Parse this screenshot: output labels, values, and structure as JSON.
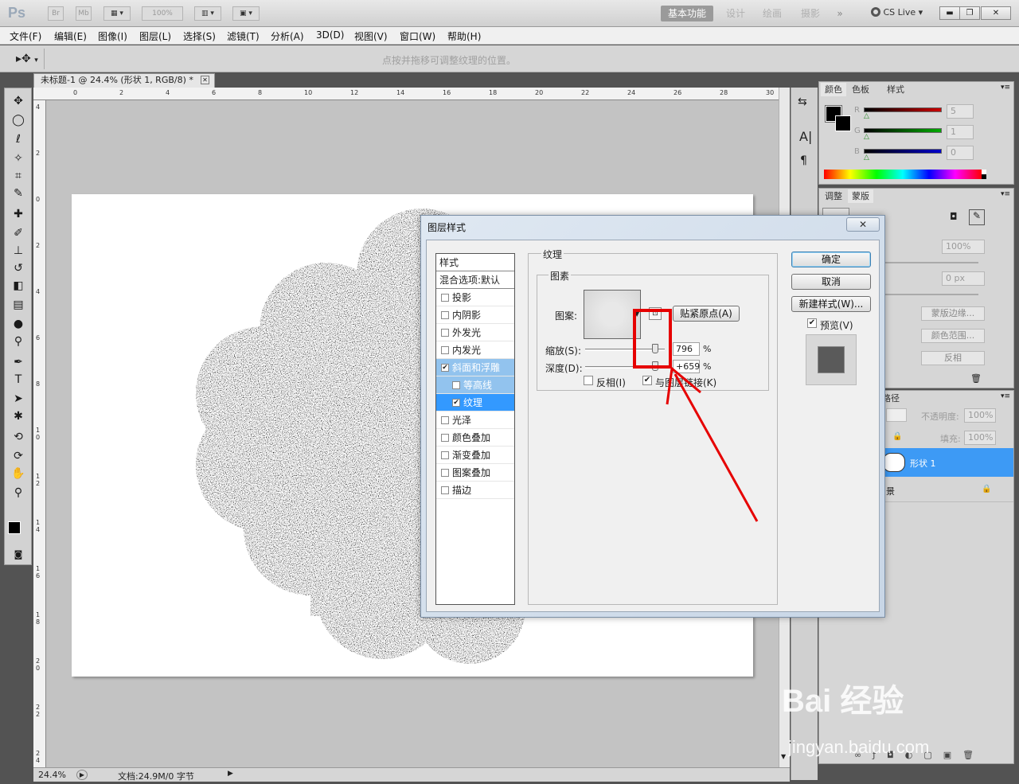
{
  "app": {
    "logo": "Ps",
    "bridge": "Br",
    "minibridge": "Mb",
    "zoom_menu": "100%",
    "workspaces": [
      "基本功能",
      "设计",
      "绘画",
      "摄影"
    ],
    "more": "»",
    "cs_live": "CS Live ▾",
    "win_min": "▬",
    "win_max": "❐",
    "win_close": "✕"
  },
  "menu": [
    "文件(F)",
    "编辑(E)",
    "图像(I)",
    "图层(L)",
    "选择(S)",
    "滤镜(T)",
    "分析(A)",
    "3D(D)",
    "视图(V)",
    "窗口(W)",
    "帮助(H)"
  ],
  "options": {
    "hint": "点按并拖移可调整纹理的位置。"
  },
  "document": {
    "tab_title": "未标题-1 @ 24.4% (形状 1, RGB/8) *",
    "tab_close": "✕",
    "ruler_h": [
      "0",
      "2",
      "4",
      "6",
      "8",
      "10",
      "12",
      "14",
      "16",
      "18",
      "20",
      "22",
      "24",
      "26",
      "28",
      "30"
    ],
    "ruler_v": [
      "4",
      "2",
      "0",
      "2",
      "4",
      "6",
      "8",
      "10",
      "12",
      "14",
      "16",
      "18",
      "20",
      "22",
      "24"
    ],
    "zoom": "24.4%",
    "doc_size": "文档:24.9M/0 字节"
  },
  "panels": {
    "color_tabs": [
      "颜色",
      "色板",
      "样式"
    ],
    "color_rows": [
      {
        "label": "R",
        "value": "5",
        "color": "#cc0000"
      },
      {
        "label": "G",
        "value": "1",
        "color": "#00aa00"
      },
      {
        "label": "B",
        "value": "0",
        "color": "#0000cc"
      }
    ],
    "adjust_tabs": [
      "调整",
      "蒙版"
    ],
    "adjust_density": "100%",
    "adjust_feather": "0 px",
    "adjust_buttons": [
      "蒙版边缘...",
      "颜色范围...",
      "反相"
    ],
    "layers_tab": "路径",
    "layer_opacity_label": "不透明度:",
    "layer_opacity": "100%",
    "layer_fill_label": "填充:",
    "layer_fill": "100%",
    "layer_shape_name": "形状 1",
    "layer_bg_name": "景"
  },
  "dialog": {
    "title": "图层样式",
    "close": "✕",
    "style_header": "样式",
    "blend_default": "混合选项:默认",
    "styles": [
      {
        "label": "投影",
        "checked": false
      },
      {
        "label": "内阴影",
        "checked": false
      },
      {
        "label": "外发光",
        "checked": false
      },
      {
        "label": "内发光",
        "checked": false
      },
      {
        "label": "斜面和浮雕",
        "checked": true,
        "state": "parent"
      },
      {
        "label": "等高线",
        "checked": false,
        "state": "sub"
      },
      {
        "label": "纹理",
        "checked": true,
        "state": "sub-selected"
      },
      {
        "label": "光泽",
        "checked": false
      },
      {
        "label": "颜色叠加",
        "checked": false
      },
      {
        "label": "渐变叠加",
        "checked": false
      },
      {
        "label": "图案叠加",
        "checked": false
      },
      {
        "label": "描边",
        "checked": false
      }
    ],
    "section_title": "纹理",
    "group_title": "图素",
    "pattern_label": "图案:",
    "snap_origin": "贴紧原点(A)",
    "scale_label": "缩放(S):",
    "scale_value": "796",
    "scale_fraction": 0.6,
    "depth_label": "深度(D):",
    "depth_value": "+659",
    "depth_fraction": 0.6,
    "percent": "%",
    "invert_label": "反相(I)",
    "invert_checked": false,
    "link_label": "与图层链接(K)",
    "link_checked": true,
    "ok": "确定",
    "cancel": "取消",
    "new_style": "新建样式(W)...",
    "preview_label": "预览(V)",
    "preview_checked": true
  },
  "watermark": {
    "brand": "Bai 经验",
    "url": "jingyan.baidu.com"
  },
  "colors": {
    "highlight_box": "#e60000",
    "selection_blue": "#3399ff",
    "layer_selected": "#3d9af5"
  }
}
